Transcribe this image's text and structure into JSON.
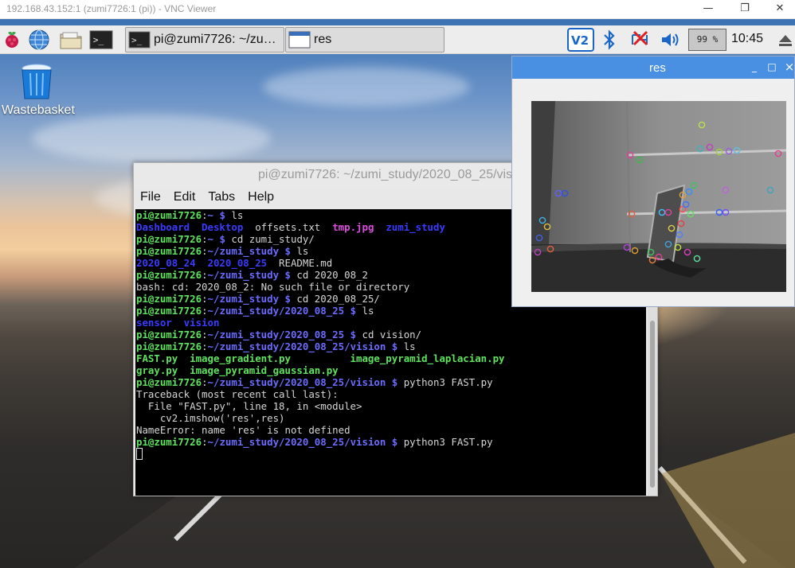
{
  "vnc": {
    "title": "192.168.43.152:1 (zumi7726:1 (pi)) - VNC Viewer",
    "minimize_glyph": "—",
    "maximize_glyph": "❐",
    "close_glyph": "✕"
  },
  "taskbar": {
    "launchers": [
      "raspberry-menu-icon",
      "web-browser-icon",
      "file-manager-icon",
      "terminal-icon"
    ],
    "tasks": [
      {
        "label": "pi@zumi7726: ~/zu…",
        "icon": "terminal-icon"
      },
      {
        "label": "res",
        "icon": "window-icon"
      }
    ],
    "tray": {
      "vnc_icon": "vnc-icon",
      "bluetooth_icon": "bluetooth-icon",
      "network_icon": "network-disconnected-icon",
      "volume_icon": "volume-icon",
      "cpu": "99 %",
      "clock": "10:45",
      "eject_icon": "eject-icon"
    }
  },
  "desktop": {
    "wastebasket_label": "Wastebasket"
  },
  "terminal": {
    "title": "pi@zumi7726: ~/zumi_study/2020_08_25/vision",
    "menu": [
      "File",
      "Edit",
      "Tabs",
      "Help"
    ],
    "lines": [
      [
        {
          "t": "pi@zumi7726",
          "c": "g"
        },
        {
          "t": ":",
          "c": "w"
        },
        {
          "t": "~ $",
          "c": "b"
        },
        {
          "t": " ls",
          "c": "w"
        }
      ],
      [
        {
          "t": "Dashboard  Desktop",
          "c": "blue"
        },
        {
          "t": "  offsets.txt  ",
          "c": "w"
        },
        {
          "t": "tmp.jpg",
          "c": "m"
        },
        {
          "t": "  ",
          "c": "w"
        },
        {
          "t": "zumi_study",
          "c": "blue"
        }
      ],
      [
        {
          "t": "pi@zumi7726",
          "c": "g"
        },
        {
          "t": ":",
          "c": "w"
        },
        {
          "t": "~ $",
          "c": "b"
        },
        {
          "t": " cd zumi_study/",
          "c": "w"
        }
      ],
      [
        {
          "t": "pi@zumi7726",
          "c": "g"
        },
        {
          "t": ":",
          "c": "w"
        },
        {
          "t": "~/zumi_study $",
          "c": "b"
        },
        {
          "t": " ls",
          "c": "w"
        }
      ],
      [
        {
          "t": "2020_08_24  2020_08_25",
          "c": "blue"
        },
        {
          "t": "  README.md",
          "c": "w"
        }
      ],
      [
        {
          "t": "pi@zumi7726",
          "c": "g"
        },
        {
          "t": ":",
          "c": "w"
        },
        {
          "t": "~/zumi_study $",
          "c": "b"
        },
        {
          "t": " cd 2020_08_2",
          "c": "w"
        }
      ],
      [
        {
          "t": "bash: cd: 2020_08_2: No such file or directory",
          "c": "w"
        }
      ],
      [
        {
          "t": "pi@zumi7726",
          "c": "g"
        },
        {
          "t": ":",
          "c": "w"
        },
        {
          "t": "~/zumi_study $",
          "c": "b"
        },
        {
          "t": " cd 2020_08_25/",
          "c": "w"
        }
      ],
      [
        {
          "t": "pi@zumi7726",
          "c": "g"
        },
        {
          "t": ":",
          "c": "w"
        },
        {
          "t": "~/zumi_study/2020_08_25 $",
          "c": "b"
        },
        {
          "t": " ls",
          "c": "w"
        }
      ],
      [
        {
          "t": "sensor  vision",
          "c": "blue"
        }
      ],
      [
        {
          "t": "pi@zumi7726",
          "c": "g"
        },
        {
          "t": ":",
          "c": "w"
        },
        {
          "t": "~/zumi_study/2020_08_25 $",
          "c": "b"
        },
        {
          "t": " cd vision/",
          "c": "w"
        }
      ],
      [
        {
          "t": "pi@zumi7726",
          "c": "g"
        },
        {
          "t": ":",
          "c": "w"
        },
        {
          "t": "~/zumi_study/2020_08_25/vision $",
          "c": "b"
        },
        {
          "t": " ls",
          "c": "w"
        }
      ],
      [
        {
          "t": "FAST.py  image_gradient.py          image_pyramid_laplacian.py",
          "c": "g"
        }
      ],
      [
        {
          "t": "gray.py  image_pyramid_gaussian.py",
          "c": "g"
        }
      ],
      [
        {
          "t": "pi@zumi7726",
          "c": "g"
        },
        {
          "t": ":",
          "c": "w"
        },
        {
          "t": "~/zumi_study/2020_08_25/vision $",
          "c": "b"
        },
        {
          "t": " python3 FAST.py",
          "c": "w"
        }
      ],
      [
        {
          "t": "Traceback (most recent call last):",
          "c": "w"
        }
      ],
      [
        {
          "t": "  File \"FAST.py\", line 18, in <module>",
          "c": "w"
        }
      ],
      [
        {
          "t": "    cv2.imshow('res',res)",
          "c": "w"
        }
      ],
      [
        {
          "t": "NameError: name 'res' is not defined",
          "c": "w"
        }
      ],
      [
        {
          "t": "pi@zumi7726",
          "c": "g"
        },
        {
          "t": ":",
          "c": "w"
        },
        {
          "t": "~/zumi_study/2020_08_25/vision $",
          "c": "b"
        },
        {
          "t": " python3 FAST.py",
          "c": "w"
        }
      ]
    ]
  },
  "res_window": {
    "title": "res",
    "minimize_glyph": "_",
    "maximize_glyph": "□",
    "close_glyph": "×"
  },
  "colors": {
    "prompt_user": "#5fe35f",
    "prompt_path": "#6b6bff",
    "dir": "#3b3bff",
    "image_file": "#e04ce0",
    "res_titlebar": "#4a90e2"
  }
}
